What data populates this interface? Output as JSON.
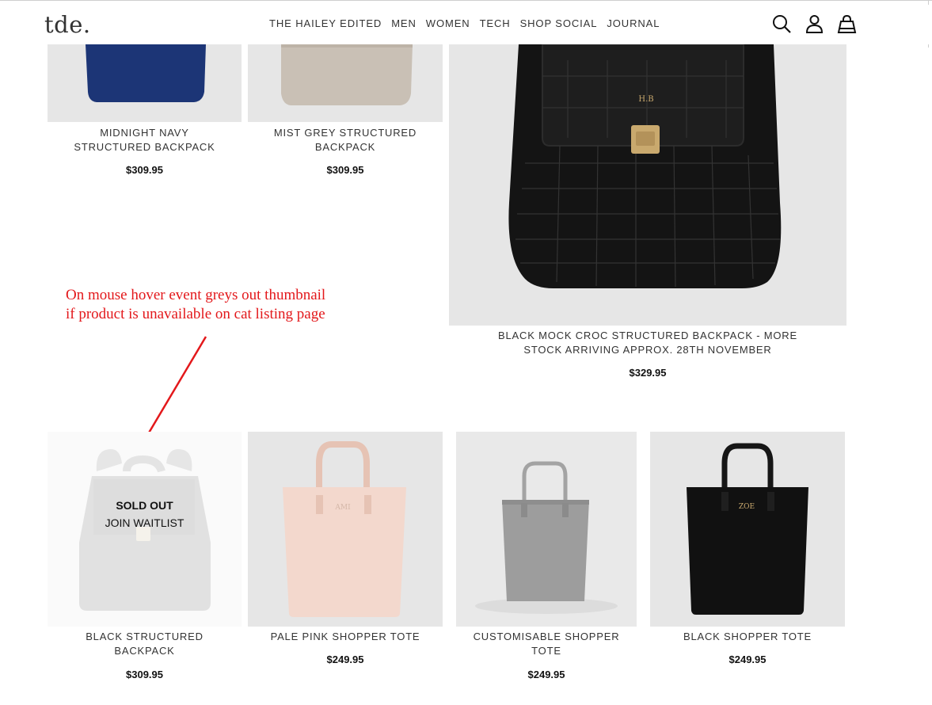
{
  "brand": {
    "logo": "tde."
  },
  "nav": [
    "THE HAILEY EDITED",
    "MEN",
    "WOMEN",
    "TECH",
    "SHOP SOCIAL",
    "JOURNAL"
  ],
  "header_icons": [
    "search-icon",
    "account-icon",
    "bag-icon"
  ],
  "products": [
    {
      "title_line1": "MIDNIGHT NAVY",
      "title_line2": "STRUCTURED BACKPACK",
      "price": "$309.95"
    },
    {
      "title_line1": "MIST GREY STRUCTURED",
      "title_line2": "BACKPACK",
      "price": "$309.95"
    },
    {
      "title_line1": "BLACK MOCK CROC STRUCTURED BACKPACK - MORE",
      "title_line2": "STOCK ARRIVING APPROX. 28TH NOVEMBER",
      "price": "$329.95"
    },
    {
      "title_line1": "BLACK STRUCTURED",
      "title_line2": "BACKPACK",
      "price": "$309.95",
      "overlay_status": "SOLD OUT",
      "overlay_action": "JOIN WAITLIST"
    },
    {
      "title_line1": "PALE PINK SHOPPER TOTE",
      "title_line2": "",
      "price": "$249.95",
      "monogram": "AMI"
    },
    {
      "title_line1": "CUSTOMISABLE SHOPPER",
      "title_line2": "TOTE",
      "price": "$249.95"
    },
    {
      "title_line1": "BLACK SHOPPER TOTE",
      "title_line2": "",
      "price": "$249.95",
      "monogram": "ZOE"
    }
  ],
  "annotation": {
    "line1": "On mouse hover event greys out thumbnail",
    "line2": "if product is unavailable on cat listing page",
    "color": "#e3181b"
  },
  "colors": {
    "thumbnail_bg": "#e6e6e6",
    "text": "#333333"
  }
}
